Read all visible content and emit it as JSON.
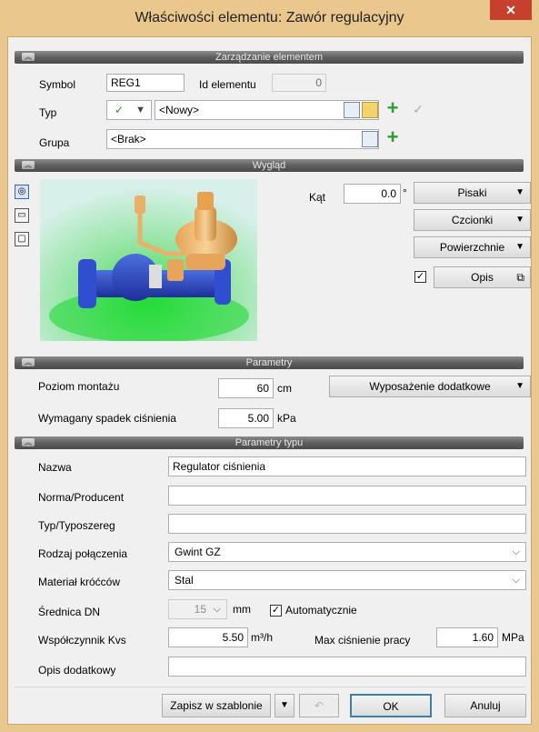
{
  "window": {
    "title": "Właściwości elementu: Zawór regulacyjny",
    "close": "✕"
  },
  "sections": {
    "management": "Zarządzanie elementem",
    "appearance": "Wygląd",
    "parameters": "Parametry",
    "type_parameters": "Parametry typu"
  },
  "management": {
    "symbol_label": "Symbol",
    "symbol_value": "REG1",
    "id_label": "Id elementu",
    "id_value": "0",
    "type_label": "Typ",
    "type_check": "✓",
    "type_value": "<Nowy>",
    "group_label": "Grupa",
    "group_value": "<Brak>"
  },
  "appearance": {
    "angle_label": "Kąt",
    "angle_value": "0.0",
    "angle_unit": "°",
    "pens": "Pisaki",
    "fonts": "Czcionki",
    "surfaces": "Powierzchnie",
    "description_checked": "✓",
    "description": "Opis"
  },
  "parameters": {
    "mount_label": "Poziom montażu",
    "mount_value": "60",
    "mount_unit": "cm",
    "drop_label": "Wymagany spadek ciśnienia",
    "drop_value": "5.00",
    "drop_unit": "kPa",
    "extra_equipment": "Wyposażenie dodatkowe"
  },
  "type_parameters": {
    "name_label": "Nazwa",
    "name_value": "Regulator ciśnienia",
    "norm_label": "Norma/Producent",
    "norm_value": "",
    "series_label": "Typ/Typoszereg",
    "series_value": "",
    "connection_label": "Rodzaj połączenia",
    "connection_value": "Gwint GZ",
    "material_label": "Materiał króćców",
    "material_value": "Stal",
    "dn_label": "Średnica DN",
    "dn_value": "15",
    "dn_unit": "mm",
    "auto_checked": "✓",
    "auto_label": "Automatycznie",
    "kvs_label": "Współczynnik Kvs",
    "kvs_value": "5.50",
    "kvs_unit": "m³/h",
    "maxp_label": "Max ciśnienie pracy",
    "maxp_value": "1.60",
    "maxp_unit": "MPa",
    "desc_label": "Opis dodatkowy",
    "desc_value": ""
  },
  "footer": {
    "save_template": "Zapisz w szablonie",
    "ok": "OK",
    "cancel": "Anuluj"
  }
}
